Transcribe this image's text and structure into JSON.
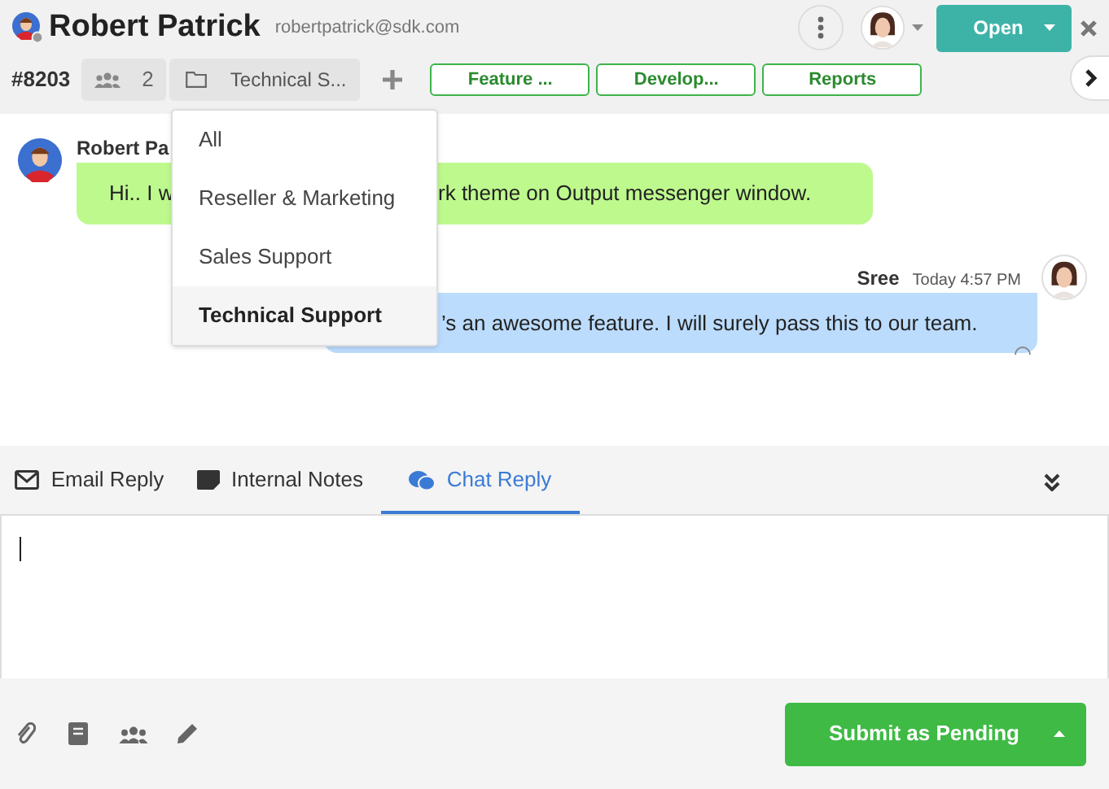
{
  "header": {
    "name": "Robert Patrick",
    "email": "robertpatrick@sdk.com",
    "status_button": "Open"
  },
  "ticket": {
    "number": "#8203",
    "participants": "2",
    "folder": "Technical S...",
    "tags": [
      {
        "label": "Feature ..."
      },
      {
        "label": "Develop..."
      },
      {
        "label": "Reports"
      }
    ]
  },
  "folder_menu": [
    {
      "label": "All",
      "selected": false
    },
    {
      "label": "Reseller & Marketing",
      "selected": false
    },
    {
      "label": "Sales Support",
      "selected": false
    },
    {
      "label": "Technical Support",
      "selected": true
    }
  ],
  "messages": [
    {
      "kind": "incoming",
      "sender": "Robert Pa",
      "text_before": "Hi.. I w",
      "text_after": "rk theme on Output messenger window."
    },
    {
      "kind": "outgoing",
      "sender": "Sree",
      "time": "Today 4:57 PM",
      "text_after": "’s an awesome feature. I will surely pass this to our team."
    }
  ],
  "reply_tabs": [
    {
      "label": "Email Reply",
      "selected": false
    },
    {
      "label": "Internal Notes",
      "selected": false
    },
    {
      "label": "Chat Reply",
      "selected": true
    }
  ],
  "submit_button": "Submit as Pending"
}
